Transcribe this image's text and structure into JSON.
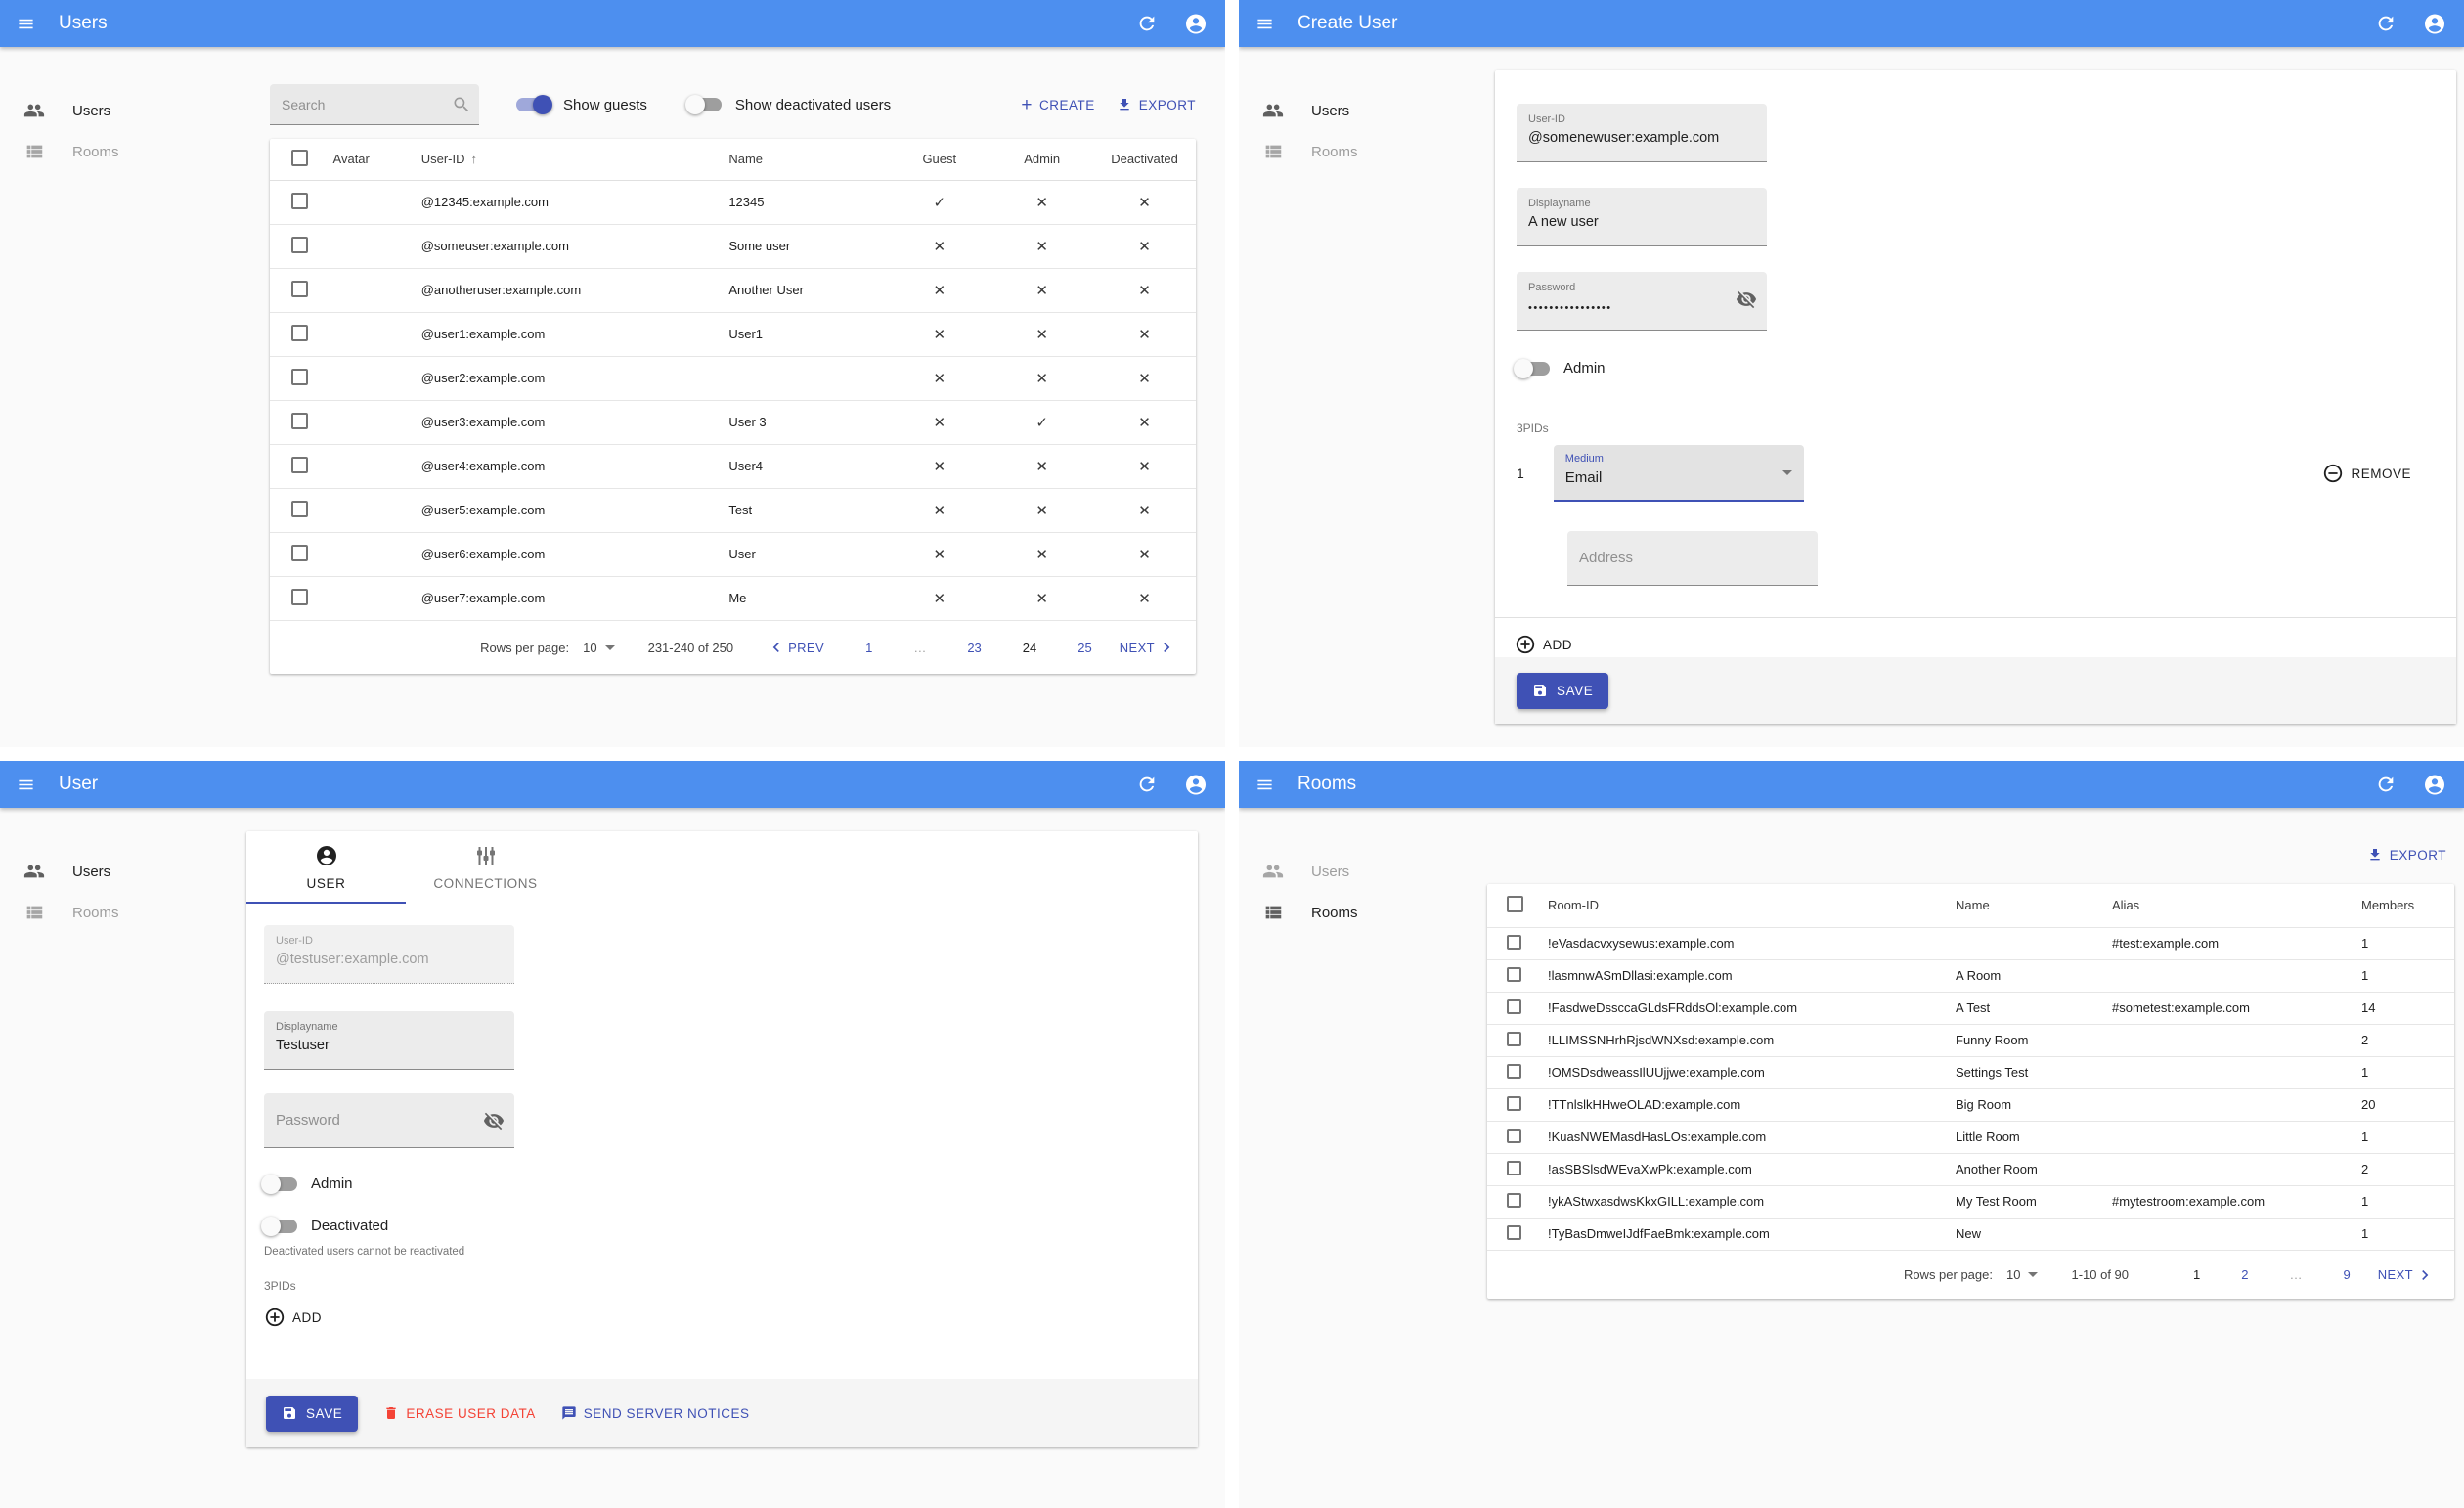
{
  "colors": {
    "appbar_blue": "#4d8fef",
    "accent_indigo": "#3f51b5",
    "danger_red": "#f44336"
  },
  "panels": {
    "users_list": {
      "title": "Users",
      "sidebar": {
        "users": "Users",
        "rooms": "Rooms"
      },
      "toolbar": {
        "search_placeholder": "Search",
        "show_guests_label": "Show guests",
        "show_guests_on": true,
        "show_deactivated_label": "Show deactivated users",
        "show_deactivated_on": false,
        "create_label": "CREATE",
        "export_label": "EXPORT"
      },
      "table": {
        "headers": {
          "avatar": "Avatar",
          "user_id": "User-ID",
          "name": "Name",
          "guest": "Guest",
          "admin": "Admin",
          "deactivated": "Deactivated"
        },
        "sort_arrow": "↑",
        "rows": [
          {
            "user_id": "@12345:example.com",
            "name": "12345",
            "guest": "✓",
            "admin": "✕",
            "deactivated": "✕"
          },
          {
            "user_id": "@someuser:example.com",
            "name": "Some user",
            "guest": "✕",
            "admin": "✕",
            "deactivated": "✕"
          },
          {
            "user_id": "@anotheruser:example.com",
            "name": "Another User",
            "guest": "✕",
            "admin": "✕",
            "deactivated": "✕"
          },
          {
            "user_id": "@user1:example.com",
            "name": "User1",
            "guest": "✕",
            "admin": "✕",
            "deactivated": "✕"
          },
          {
            "user_id": "@user2:example.com",
            "name": "",
            "guest": "✕",
            "admin": "✕",
            "deactivated": "✕"
          },
          {
            "user_id": "@user3:example.com",
            "name": "User 3",
            "guest": "✕",
            "admin": "✓",
            "deactivated": "✕"
          },
          {
            "user_id": "@user4:example.com",
            "name": "User4",
            "guest": "✕",
            "admin": "✕",
            "deactivated": "✕"
          },
          {
            "user_id": "@user5:example.com",
            "name": "Test",
            "guest": "✕",
            "admin": "✕",
            "deactivated": "✕"
          },
          {
            "user_id": "@user6:example.com",
            "name": "User",
            "guest": "✕",
            "admin": "✕",
            "deactivated": "✕"
          },
          {
            "user_id": "@user7:example.com",
            "name": "Me",
            "guest": "✕",
            "admin": "✕",
            "deactivated": "✕"
          }
        ]
      },
      "pagination": {
        "rows_per_page_label": "Rows per page:",
        "rows_per_page": "10",
        "range": "231-240 of 250",
        "prev": "PREV",
        "next": "NEXT",
        "pages": [
          "1",
          "…",
          "23",
          "24",
          "25"
        ],
        "current_page": "24"
      }
    },
    "create_user": {
      "title": "Create User",
      "sidebar": {
        "users": "Users",
        "rooms": "Rooms"
      },
      "form": {
        "user_id_label": "User-ID",
        "user_id_value": "@somenewuser:example.com",
        "displayname_label": "Displayname",
        "displayname_value": "A new user",
        "password_label": "Password",
        "password_value": "••••••••••••••••",
        "admin_label": "Admin",
        "admin_on": false,
        "threepids_label": "3PIDs",
        "row_index": "1",
        "medium_label": "Medium",
        "medium_value": "Email",
        "remove_label": "REMOVE",
        "address_placeholder": "Address",
        "add_label": "ADD",
        "save_label": "SAVE"
      }
    },
    "user_edit": {
      "title": "User",
      "sidebar": {
        "users": "Users",
        "rooms": "Rooms"
      },
      "tabs": {
        "user": "USER",
        "connections": "CONNECTIONS"
      },
      "form": {
        "user_id_label": "User-ID",
        "user_id_value": "@testuser:example.com",
        "displayname_label": "Displayname",
        "displayname_value": "Testuser",
        "password_placeholder": "Password",
        "admin_label": "Admin",
        "admin_on": false,
        "deactivated_label": "Deactivated",
        "deactivated_on": false,
        "deactivated_helper": "Deactivated users cannot be reactivated",
        "threepids_label": "3PIDs",
        "add_label": "ADD",
        "save_label": "SAVE",
        "erase_label": "ERASE USER DATA",
        "notices_label": "SEND SERVER NOTICES"
      }
    },
    "rooms_list": {
      "title": "Rooms",
      "sidebar": {
        "users": "Users",
        "rooms": "Rooms"
      },
      "toolbar": {
        "export_label": "EXPORT"
      },
      "table": {
        "headers": {
          "room_id": "Room-ID",
          "name": "Name",
          "alias": "Alias",
          "members": "Members"
        },
        "rows": [
          {
            "room_id": "!eVasdacvxysewus:example.com",
            "name": "",
            "alias": "#test:example.com",
            "members": "1"
          },
          {
            "room_id": "!lasmnwASmDllasi:example.com",
            "name": "A Room",
            "alias": "",
            "members": "1"
          },
          {
            "room_id": "!FasdweDssccaGLdsFRddsOl:example.com",
            "name": "A Test",
            "alias": "#sometest:example.com",
            "members": "14"
          },
          {
            "room_id": "!LLIMSSNHrhRjsdWNXsd:example.com",
            "name": "Funny Room",
            "alias": "",
            "members": "2"
          },
          {
            "room_id": "!OMSDsdweassIlUUjjwe:example.com",
            "name": "Settings Test",
            "alias": "",
            "members": "1"
          },
          {
            "room_id": "!TTnlslkHHweOLAD:example.com",
            "name": "Big Room",
            "alias": "",
            "members": "20"
          },
          {
            "room_id": "!KuasNWEMasdHasLOs:example.com",
            "name": "Little Room",
            "alias": "",
            "members": "1"
          },
          {
            "room_id": "!asSBSlsdWEvaXwPk:example.com",
            "name": "Another Room",
            "alias": "",
            "members": "2"
          },
          {
            "room_id": "!ykAStwxasdwsKkxGILL:example.com",
            "name": "My Test Room",
            "alias": "#mytestroom:example.com",
            "members": "1"
          },
          {
            "room_id": "!TyBasDmweIJdfFaeBmk:example.com",
            "name": "New",
            "alias": "",
            "members": "1"
          }
        ]
      },
      "pagination": {
        "rows_per_page_label": "Rows per page:",
        "rows_per_page": "10",
        "range": "1-10 of 90",
        "next": "NEXT",
        "pages": [
          "1",
          "2",
          "…",
          "9"
        ],
        "current_page": "1"
      }
    }
  }
}
